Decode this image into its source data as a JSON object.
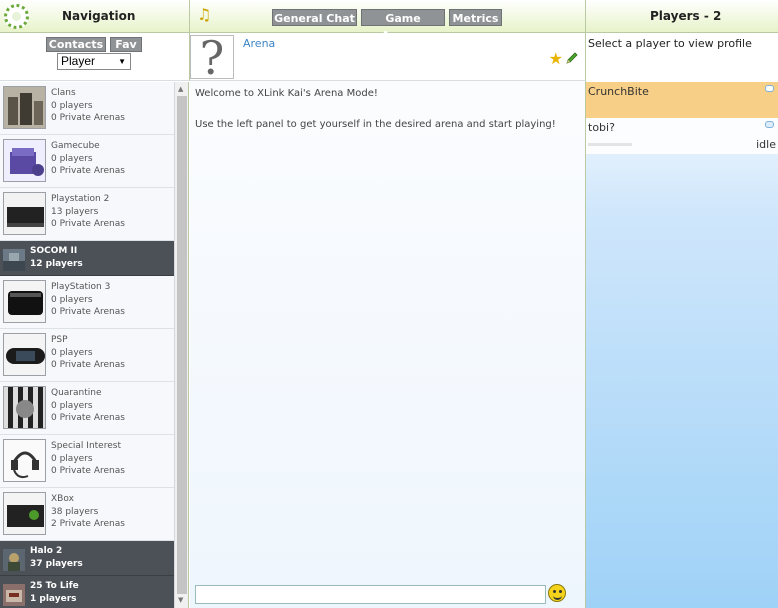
{
  "nav": {
    "title": "Navigation",
    "contacts_label": "Contacts",
    "fav_label": "Fav",
    "filter_value": "Player"
  },
  "tabs": {
    "general_chat": "General Chat",
    "game_arenas": "Game Arenas",
    "metrics": "Metrics"
  },
  "arena": {
    "name": "Arena",
    "welcome": "Welcome to XLink Kai's Arena Mode!",
    "instructions": "Use the left panel to get yourself in the desired arena and start playing!"
  },
  "players_panel": {
    "title": "Players - 2",
    "hint": "Select a player to view profile",
    "players": [
      {
        "name": "CrunchBite",
        "status": ""
      },
      {
        "name": "tobi?",
        "status": "idle"
      }
    ]
  },
  "arenas": [
    {
      "name": "Clans",
      "players": "0 players",
      "private": "0 Private Arenas",
      "icon": "clans-icon",
      "kind": "normal"
    },
    {
      "name": "Gamecube",
      "players": "0 players",
      "private": "0 Private Arenas",
      "icon": "gamecube-icon",
      "kind": "normal"
    },
    {
      "name": "Playstation 2",
      "players": "13 players",
      "private": "0 Private Arenas",
      "icon": "playstation2-icon",
      "kind": "normal"
    },
    {
      "name": "SOCOM II",
      "players": "12 players",
      "icon": "socom-icon",
      "kind": "dark"
    },
    {
      "name": "PlayStation 3",
      "players": "0 players",
      "private": "0 Private Arenas",
      "icon": "playstation3-icon",
      "kind": "normal"
    },
    {
      "name": "PSP",
      "players": "0 players",
      "private": "0 Private Arenas",
      "icon": "psp-icon",
      "kind": "normal"
    },
    {
      "name": "Quarantine",
      "players": "0 players",
      "private": "0 Private Arenas",
      "icon": "quarantine-icon",
      "kind": "normal"
    },
    {
      "name": "Special Interest",
      "players": "0 players",
      "private": "0 Private Arenas",
      "icon": "headset-icon",
      "kind": "normal"
    },
    {
      "name": "XBox",
      "players": "38 players",
      "private": "2 Private Arenas",
      "icon": "xbox-icon",
      "kind": "normal"
    },
    {
      "name": "Halo 2",
      "players": "37 players",
      "icon": "halo2-icon",
      "kind": "dark"
    },
    {
      "name": "25 To Life",
      "players": "1 players",
      "icon": "25tolife-icon",
      "kind": "dark"
    }
  ]
}
